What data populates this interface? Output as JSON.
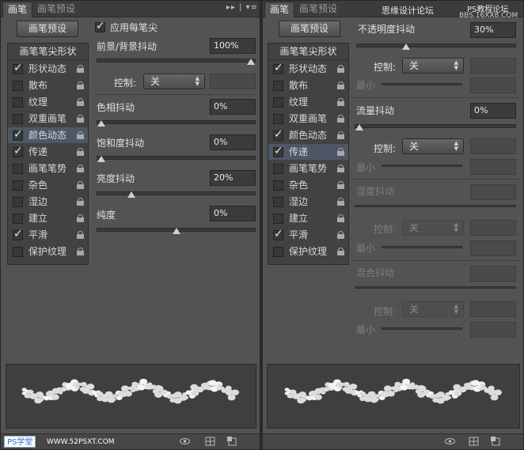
{
  "left": {
    "tabs": [
      "画笔",
      "画笔预设"
    ],
    "tab_menu": "▸▸ | ▾≡",
    "preset_button": "画笔预设",
    "sidebar": {
      "header": "画笔笔尖形状",
      "items": [
        {
          "label": "形状动态",
          "checked": true,
          "lock": true,
          "highlight": false
        },
        {
          "label": "散布",
          "checked": false,
          "lock": true,
          "highlight": false
        },
        {
          "label": "纹理",
          "checked": false,
          "lock": true,
          "highlight": false
        },
        {
          "label": "双重画笔",
          "checked": false,
          "lock": true,
          "highlight": false
        },
        {
          "label": "颜色动态",
          "checked": true,
          "lock": true,
          "highlight": true
        },
        {
          "label": "传递",
          "checked": true,
          "lock": true,
          "highlight": false
        },
        {
          "label": "画笔笔势",
          "checked": false,
          "lock": true,
          "highlight": false
        },
        {
          "label": "杂色",
          "checked": false,
          "lock": true,
          "highlight": false
        },
        {
          "label": "湿边",
          "checked": false,
          "lock": true,
          "highlight": false
        },
        {
          "label": "建立",
          "checked": false,
          "lock": true,
          "highlight": false
        },
        {
          "label": "平滑",
          "checked": true,
          "lock": true,
          "highlight": false
        },
        {
          "label": "保护纹理",
          "checked": false,
          "lock": true,
          "highlight": false
        }
      ]
    },
    "apply_tip": "应用每笔尖",
    "fg_bg": {
      "label": "前景/背景抖动",
      "value": "100%",
      "level": 1.0
    },
    "control": {
      "label": "控制:",
      "value": "关"
    },
    "hue": {
      "label": "色相抖动",
      "value": "0%",
      "level": 0.0
    },
    "saturation": {
      "label": "饱和度抖动",
      "value": "0%",
      "level": 0.0
    },
    "brightness": {
      "label": "亮度抖动",
      "value": "20%",
      "level": 0.2
    },
    "purity": {
      "label": "纯度",
      "value": "0%",
      "level": 0.5
    },
    "watermark_logo": "PS学堂",
    "watermark_site": "WWW.52PSXT.COM"
  },
  "right": {
    "tabs": [
      "画笔",
      "画笔预设"
    ],
    "watermark_top": "思缘设计论坛",
    "watermark_top2": "PS教程论坛",
    "watermark_bbs": "BBS.16XX8.COM",
    "preset_button": "画笔预设",
    "sidebar": {
      "header": "画笔笔尖形状",
      "items": [
        {
          "label": "形状动态",
          "checked": true,
          "lock": true,
          "highlight": false
        },
        {
          "label": "散布",
          "checked": false,
          "lock": true,
          "highlight": false
        },
        {
          "label": "纹理",
          "checked": false,
          "lock": true,
          "highlight": false
        },
        {
          "label": "双重画笔",
          "checked": false,
          "lock": true,
          "highlight": false
        },
        {
          "label": "颜色动态",
          "checked": true,
          "lock": true,
          "highlight": false
        },
        {
          "label": "传递",
          "checked": true,
          "lock": true,
          "highlight": true
        },
        {
          "label": "画笔笔势",
          "checked": false,
          "lock": true,
          "highlight": false
        },
        {
          "label": "杂色",
          "checked": false,
          "lock": true,
          "highlight": false
        },
        {
          "label": "湿边",
          "checked": false,
          "lock": true,
          "highlight": false
        },
        {
          "label": "建立",
          "checked": false,
          "lock": true,
          "highlight": false
        },
        {
          "label": "平滑",
          "checked": true,
          "lock": true,
          "highlight": false
        },
        {
          "label": "保护纹理",
          "checked": false,
          "lock": true,
          "highlight": false
        }
      ]
    },
    "opacity": {
      "label": "不透明度抖动",
      "value": "30%",
      "level": 0.3
    },
    "control1": {
      "label": "控制:",
      "value": "关"
    },
    "min1": "最小",
    "flow": {
      "label": "流量抖动",
      "value": "0%",
      "level": 0.0
    },
    "control2": {
      "label": "控制:",
      "value": "关"
    },
    "min2": "最小",
    "wet": {
      "label": "湿度抖动"
    },
    "control3": {
      "label": "控制:",
      "value": "关"
    },
    "min3": "最小",
    "mix": {
      "label": "混合抖动"
    },
    "control4": {
      "label": "控制:",
      "value": "关"
    },
    "min4": "最小"
  }
}
